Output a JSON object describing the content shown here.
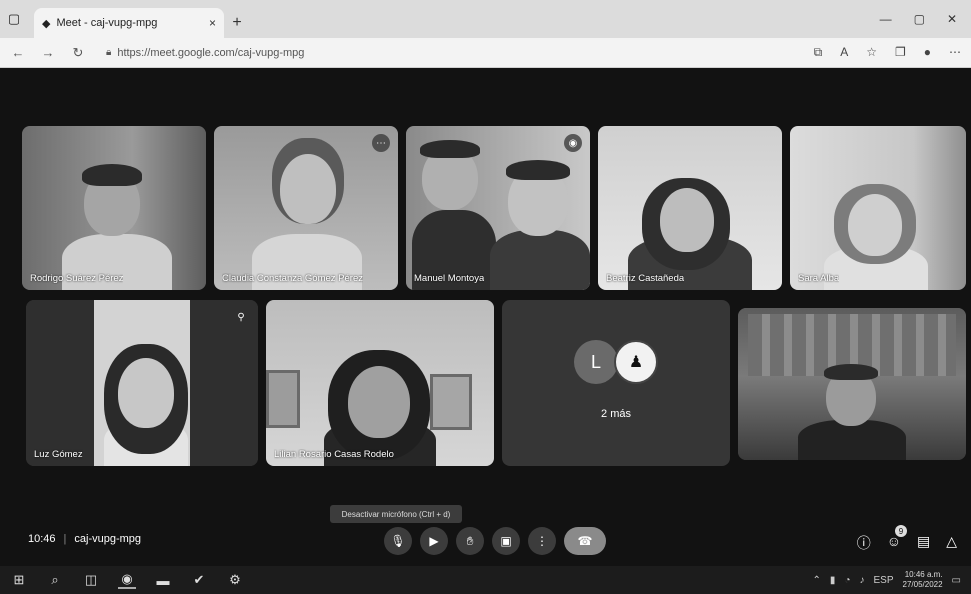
{
  "browser": {
    "tab_title": "Meet - caj-vupg-mpg",
    "tab_close": "×",
    "new_tab": "+",
    "url": "https://meet.google.com/caj-vupg-mpg",
    "window_controls": [
      "—",
      "▢",
      "✕"
    ],
    "toolbar_icons": [
      "extensions-icon",
      "reading-icon",
      "favorites-icon",
      "collections-icon",
      "profile-icon",
      "more-icon"
    ]
  },
  "participants": {
    "row1": [
      {
        "name": "Rodrigo Suárez Pérez"
      },
      {
        "name": "Claudia Constanza Gómez Pérez"
      },
      {
        "name": "Manuel Montoya"
      },
      {
        "name": "Beatriz Castañeda"
      },
      {
        "name": "Sara Alba"
      }
    ],
    "row2": [
      {
        "name": "Luz Gómez"
      },
      {
        "name": "Lilian Rosario Casas Rodelo"
      },
      {
        "name": "2 más"
      },
      {
        "name": ""
      }
    ],
    "avatar_letter": "L"
  },
  "bottom": {
    "tooltip": "Desactivar micrófono (Ctrl + d)",
    "time": "10:46",
    "separator": "|",
    "meeting_code": "caj-vupg-mpg",
    "people_count": "9"
  },
  "taskbar": {
    "clock_time": "10:46 a.m.",
    "clock_date": "27/05/2022",
    "lang": "ESP"
  }
}
